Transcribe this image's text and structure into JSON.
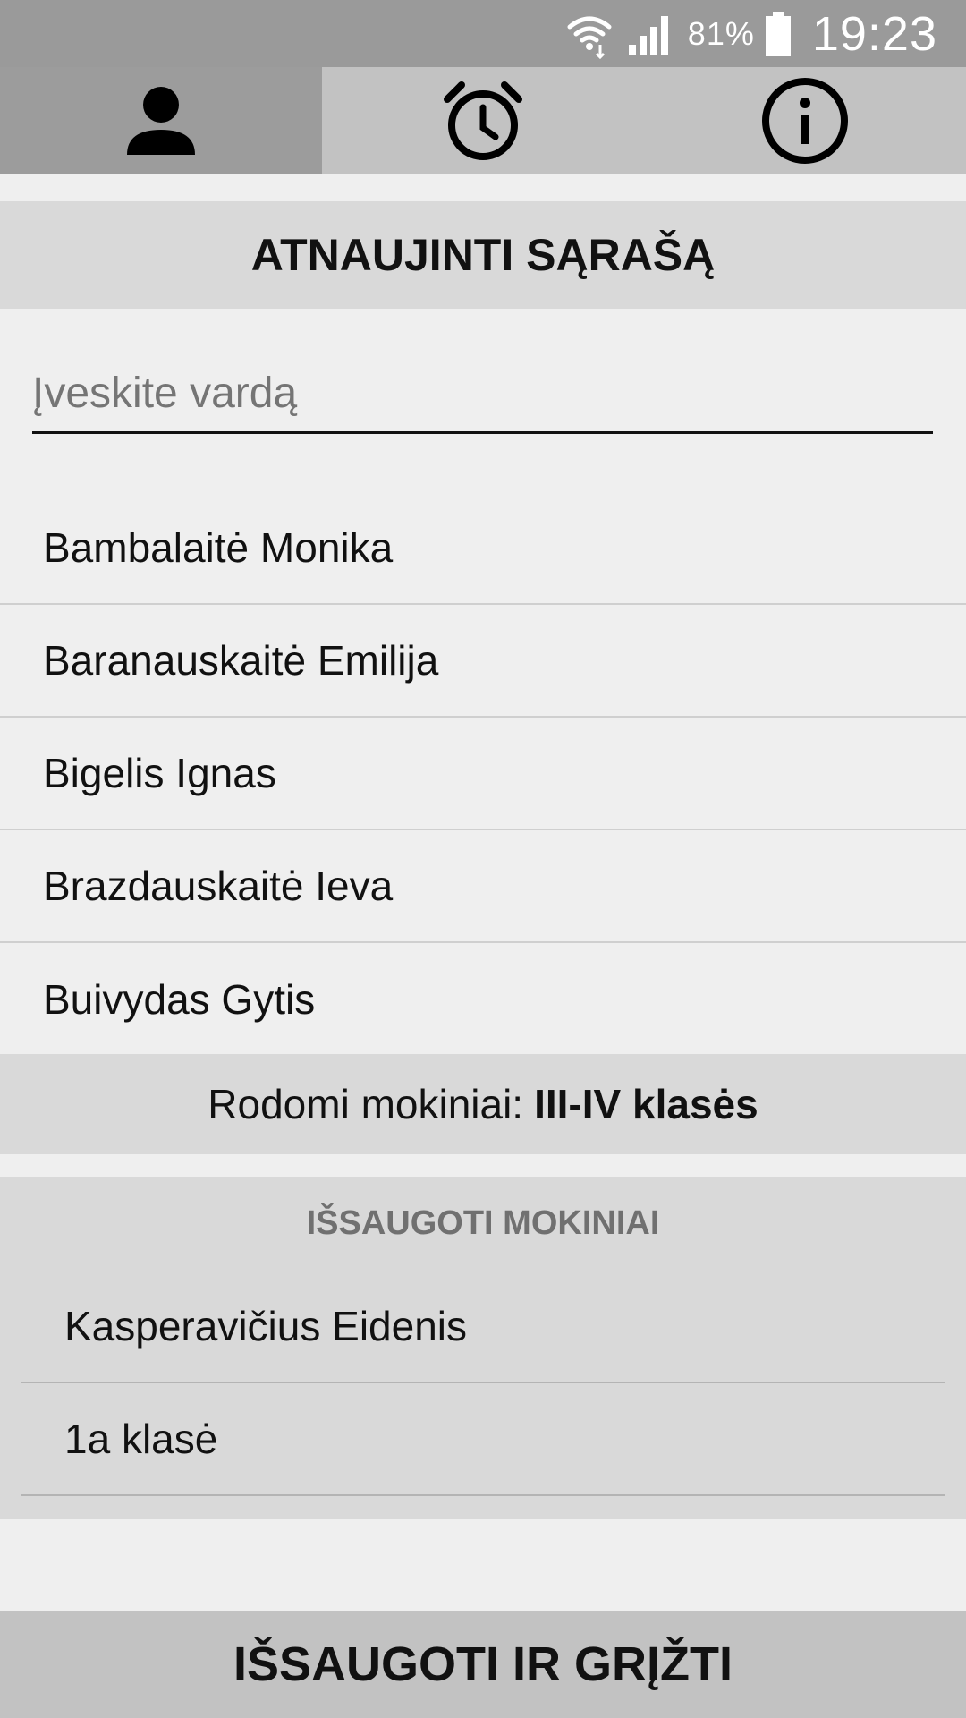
{
  "status_bar": {
    "battery_percent": "81%",
    "time": "19:23",
    "icons": [
      "wifi-icon",
      "signal-icon",
      "battery-icon"
    ]
  },
  "tabs": [
    {
      "icon": "person-icon",
      "active": true
    },
    {
      "icon": "alarm-clock-icon",
      "active": false
    },
    {
      "icon": "info-icon",
      "active": false
    }
  ],
  "refresh_button": {
    "label": "ATNAUJINTI SĄRAŠĄ"
  },
  "search": {
    "placeholder": "Įveskite vardą",
    "value": ""
  },
  "students": [
    {
      "name": "Bambalaitė Monika"
    },
    {
      "name": "Baranauskaitė Emilija"
    },
    {
      "name": "Bigelis Ignas"
    },
    {
      "name": "Brazdauskaitė Ieva"
    },
    {
      "name": "Buivydas Gytis"
    }
  ],
  "shown_info": {
    "label": "Rodomi mokiniai:",
    "value": "III-IV klasės"
  },
  "saved": {
    "title": "IŠSAUGOTI MOKINIAI",
    "items": [
      {
        "name": "Kasperavičius Eidenis"
      },
      {
        "name": "1a klasė"
      }
    ]
  },
  "save_return_button": {
    "label": "IŠSAUGOTI IR GRĮŽTI"
  },
  "colors": {
    "status_bar": "#9a9a9a",
    "tab_bar": "#c2c2c2",
    "tab_active": "#9c9c9c",
    "panel": "#d9d9d9",
    "background": "#efefef"
  }
}
